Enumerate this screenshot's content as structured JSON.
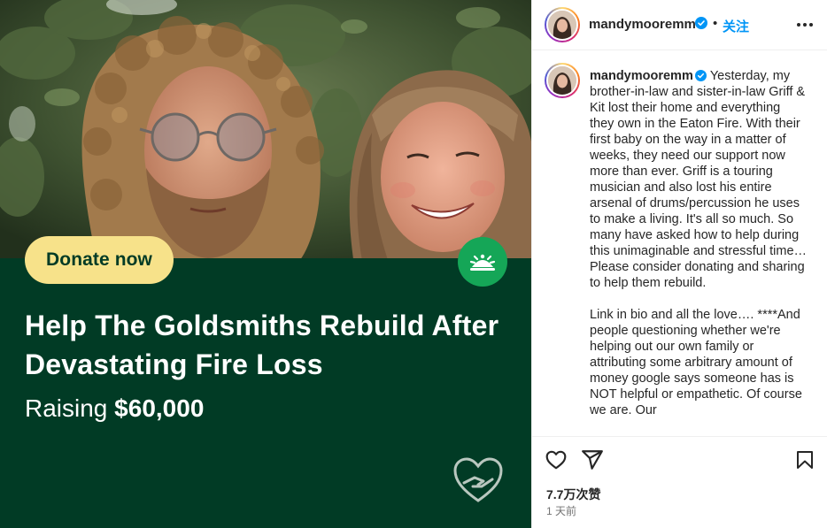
{
  "post": {
    "username": "mandymooremm",
    "follow_label": "关注",
    "dot": "•",
    "caption_paragraphs": [
      "Yesterday, my brother-in-law and sister-in-law Griff & Kit lost their home and everything they own in the Eaton Fire. With their first baby on the way in a matter of weeks, they need our support now more than ever. Griff is a touring musician and also lost his entire arsenal of drums/percussion he uses to make a living. It's all so much. So many have asked how to help during this unimaginable and stressful time… Please consider donating and sharing to help them rebuild.",
      "Link in bio and all the love…. ****And people questioning whether we're helping out our own family or attributing some arbitrary amount of money google says someone has is NOT helpful or empathetic. Of course we are. Our"
    ],
    "likes": "7.7万次赞",
    "time_ago": "1 天前"
  },
  "media": {
    "donate_label": "Donate now",
    "campaign_title": "Help The Goldsmiths Rebuild After Devastating Fire Loss",
    "raising_prefix": "Raising",
    "raising_amount": "$60,000"
  },
  "colors": {
    "brand_green": "#013b25",
    "logo_green": "#15a657",
    "donate_yellow": "#f7e28a",
    "follow_blue": "#0095f6",
    "verified_blue": "#0095f6"
  },
  "icons": [
    "verified-badge-icon",
    "more-options-icon",
    "heart-icon",
    "share-icon",
    "bookmark-icon",
    "gofundme-logo-icon",
    "heart-hand-icon"
  ]
}
